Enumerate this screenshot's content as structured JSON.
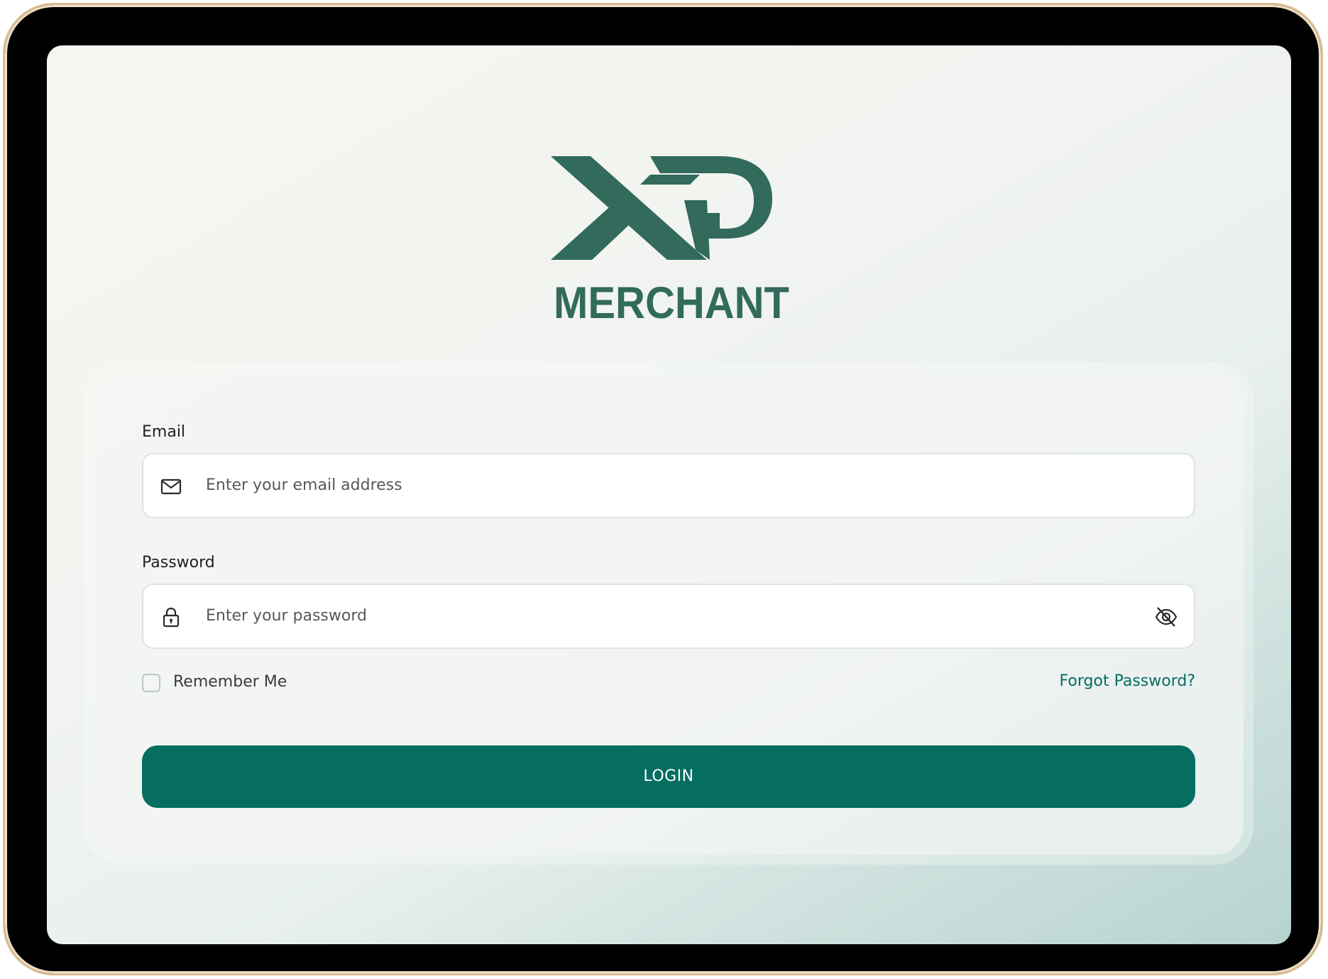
{
  "brand": {
    "logo_letters": "XP",
    "name": "MERCHANT",
    "color": "#326a5c"
  },
  "form": {
    "email": {
      "label": "Email",
      "placeholder": "Enter your email address",
      "icon": "mail-icon"
    },
    "password": {
      "label": "Password",
      "placeholder": "Enter your password",
      "icon": "lock-icon",
      "toggle_icon": "eye-off-icon"
    },
    "remember_me": {
      "label": "Remember Me",
      "checked": false
    },
    "forgot_password_label": "Forgot Password?",
    "login_label": "LOGIN"
  },
  "colors": {
    "accent": "#056e61",
    "logo": "#326a5c",
    "device_frame": "#d9bd93"
  }
}
